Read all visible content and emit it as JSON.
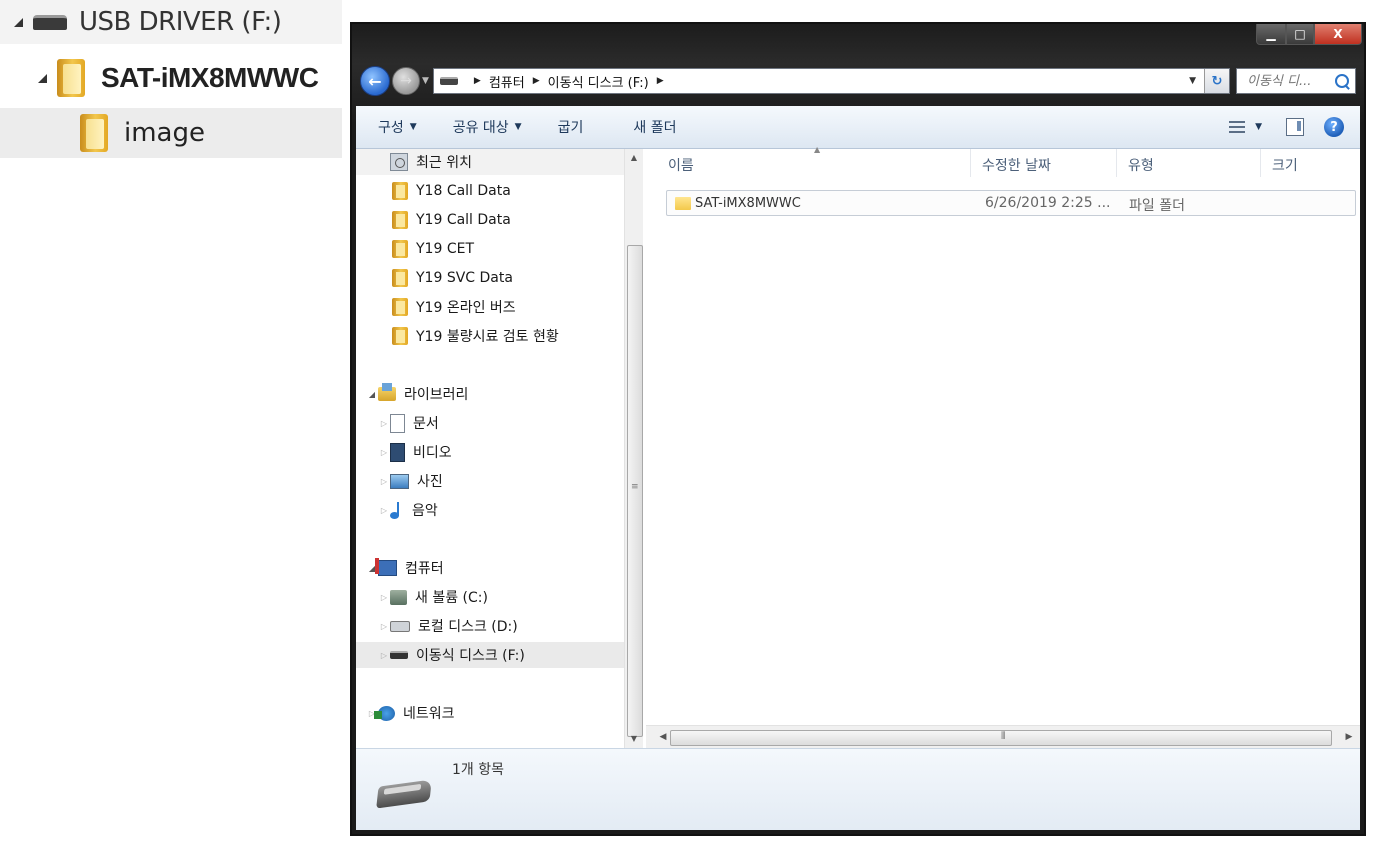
{
  "left_tree": {
    "drive_label": "USB DRIVER  (F:)",
    "folder_label": "SAT-iMX8MWWC",
    "subfolder_label": "image"
  },
  "window": {
    "caption": {
      "minimize": "▁",
      "maximize": "□",
      "close": "X"
    },
    "address": {
      "crumbs": [
        "컴퓨터",
        "이동식 디스크 (F:)"
      ]
    },
    "search": {
      "placeholder": "이동식 디..."
    },
    "toolbar": {
      "organize": "구성",
      "share": "공유 대상",
      "burn": "굽기",
      "new_folder": "새 폴더"
    },
    "nav": {
      "recent": "최근 위치",
      "favorites": [
        "Y18 Call Data",
        "Y19 Call Data",
        "Y19 CET",
        "Y19 SVC Data",
        "Y19 온라인 버즈",
        "Y19 불량시료 검토 현황"
      ],
      "libraries": "라이브러리",
      "lib_items": [
        "문서",
        "비디오",
        "사진",
        "음악"
      ],
      "computer": "컴퓨터",
      "drives": [
        "새 볼륨 (C:)",
        "로컬 디스크 (D:)",
        "이동식 디스크 (F:)"
      ],
      "network": "네트워크"
    },
    "columns": {
      "name": "이름",
      "date": "수정한 날짜",
      "type": "유형",
      "size": "크기"
    },
    "files": [
      {
        "name": "SAT-iMX8MWWC",
        "date": "6/26/2019 2:25 ...",
        "type": "파일 폴더"
      }
    ],
    "status": {
      "item_count": "1개 항목"
    }
  }
}
